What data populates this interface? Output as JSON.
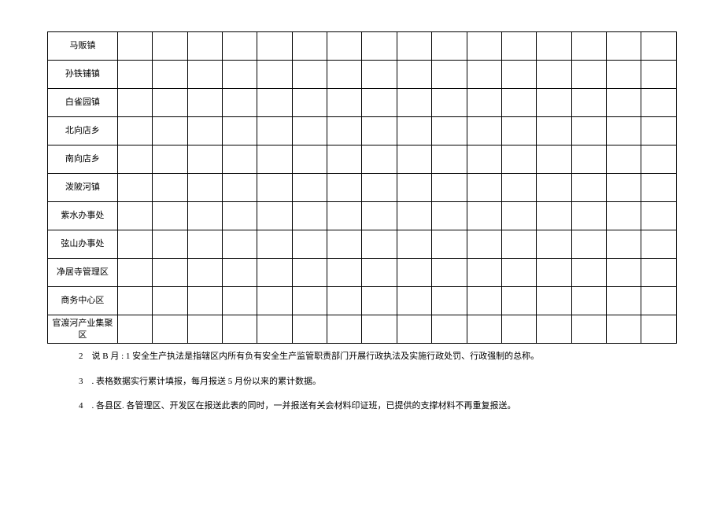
{
  "table": {
    "rows": [
      {
        "label": "马贩镇"
      },
      {
        "label": "孙铁铺镇"
      },
      {
        "label": "白雀园镇"
      },
      {
        "label": "北向店乡"
      },
      {
        "label": "南向店乡"
      },
      {
        "label": "泼陂河镇"
      },
      {
        "label": "紫水办事处"
      },
      {
        "label": "弦山办事处"
      },
      {
        "label": "净居寺管理区"
      },
      {
        "label": "商务中心区"
      },
      {
        "label": "官渡河产业集聚区"
      }
    ],
    "data_columns": 16
  },
  "notes": {
    "n1": "2　说 B 月 : 1 安全生产执法是指辖区内所有负有安全生产监管职责部门开展行政执法及实施行政处罚、行政强制的总称。",
    "n2": "3　. 表格数据实行累计填报，每月报送 5 月份以来的累计数据。",
    "n3": "4　. 各县区. 各管理区、开发区在报送此表的同时，一并报送有关会材料印证班，已提供的支撑材料不再重复报送。"
  }
}
